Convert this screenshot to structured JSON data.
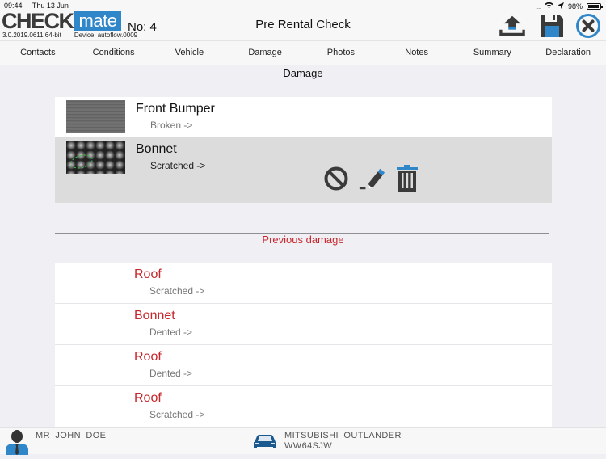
{
  "status_bar": {
    "time": "09:44",
    "date": "Thu 13 Jun",
    "battery": "98%",
    "icons": [
      "signal-dots-icon",
      "wifi-icon",
      "location-icon",
      "battery-icon"
    ]
  },
  "header": {
    "logo_part1": "CHECK",
    "logo_part2": "mate",
    "version": "3.0.2019.0611 64-bit",
    "device": "Device: autoflow.0009",
    "number_label": "No: 4",
    "title": "Pre Rental Check",
    "buttons": [
      {
        "name": "upload-icon"
      },
      {
        "name": "save-icon"
      },
      {
        "name": "close-icon"
      }
    ],
    "accent": "#2f86c9"
  },
  "tabs": [
    {
      "label": "Contacts"
    },
    {
      "label": "Conditions"
    },
    {
      "label": "Vehicle"
    },
    {
      "label": "Damage"
    },
    {
      "label": "Photos"
    },
    {
      "label": "Notes"
    },
    {
      "label": "Summary"
    },
    {
      "label": "Declaration"
    }
  ],
  "damage": {
    "section_title": "Damage",
    "items": [
      {
        "name": "Front Bumper",
        "condition": "Broken  ->",
        "selected": false
      },
      {
        "name": "Bonnet",
        "condition": "Scratched  ->",
        "selected": true
      }
    ],
    "actions": [
      "block-icon",
      "edit-icon",
      "trash-icon"
    ]
  },
  "previous_damage": {
    "title": "Previous damage",
    "color": "#c8262b",
    "items": [
      {
        "name": "Roof",
        "condition": "Scratched  ->"
      },
      {
        "name": "Bonnet",
        "condition": "Dented  ->"
      },
      {
        "name": "Roof",
        "condition": "Dented  ->"
      },
      {
        "name": "Roof",
        "condition": "Scratched  ->"
      }
    ]
  },
  "footer": {
    "customer": "MR  JOHN  DOE",
    "vehicle_model": "MITSUBISHI  OUTLANDER",
    "registration": "WW64SJW"
  }
}
